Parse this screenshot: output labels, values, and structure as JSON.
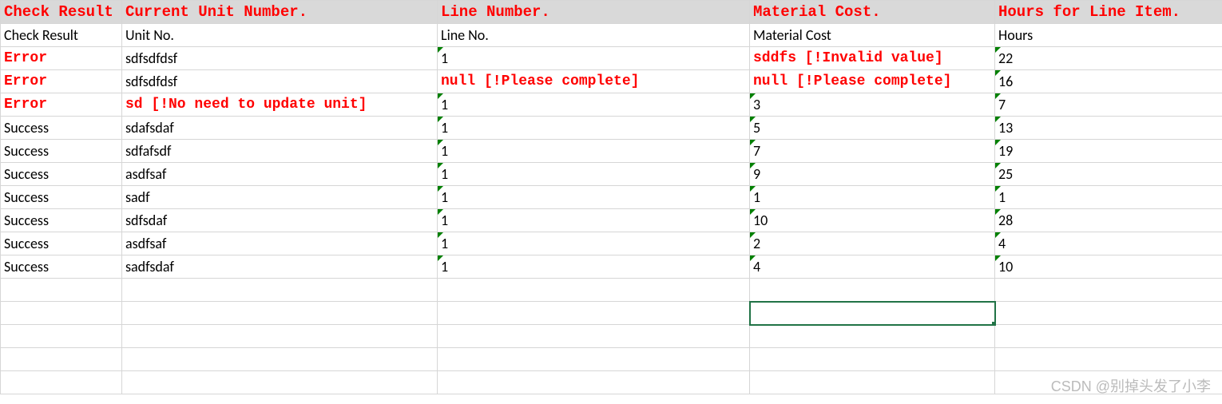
{
  "header": {
    "cols": [
      "Check Result",
      "Current Unit Number.",
      "Line Number.",
      "Material Cost.",
      "Hours for Line Item."
    ]
  },
  "labels": {
    "cols": [
      "Check Result",
      "Unit No.",
      "Line No.",
      "Material Cost",
      "Hours"
    ]
  },
  "rows": [
    {
      "status": {
        "text": "Error",
        "err": true
      },
      "unit": {
        "text": "sdfsdfdsf",
        "err": false
      },
      "line": {
        "text": "1",
        "err": false,
        "flag": true
      },
      "cost": {
        "text": "sddfs [!Invalid value]",
        "err": true
      },
      "hours": {
        "text": "22",
        "err": false,
        "flag": true
      }
    },
    {
      "status": {
        "text": "Error",
        "err": true
      },
      "unit": {
        "text": "sdfsdfdsf",
        "err": false
      },
      "line": {
        "text": "null [!Please complete]",
        "err": true
      },
      "cost": {
        "text": "null [!Please complete]",
        "err": true
      },
      "hours": {
        "text": "16",
        "err": false,
        "flag": true
      }
    },
    {
      "status": {
        "text": "Error",
        "err": true
      },
      "unit": {
        "text": "sd [!No need to update unit]",
        "err": true
      },
      "line": {
        "text": "1",
        "err": false,
        "flag": true
      },
      "cost": {
        "text": "3",
        "err": false,
        "flag": true
      },
      "hours": {
        "text": "7",
        "err": false,
        "flag": true
      }
    },
    {
      "status": {
        "text": "Success",
        "err": false
      },
      "unit": {
        "text": "sdafsdaf",
        "err": false
      },
      "line": {
        "text": "1",
        "err": false,
        "flag": true
      },
      "cost": {
        "text": "5",
        "err": false,
        "flag": true
      },
      "hours": {
        "text": "13",
        "err": false,
        "flag": true
      }
    },
    {
      "status": {
        "text": "Success",
        "err": false
      },
      "unit": {
        "text": "sdfafsdf",
        "err": false
      },
      "line": {
        "text": "1",
        "err": false,
        "flag": true
      },
      "cost": {
        "text": "7",
        "err": false,
        "flag": true
      },
      "hours": {
        "text": "19",
        "err": false,
        "flag": true
      }
    },
    {
      "status": {
        "text": "Success",
        "err": false
      },
      "unit": {
        "text": "asdfsaf",
        "err": false
      },
      "line": {
        "text": "1",
        "err": false,
        "flag": true
      },
      "cost": {
        "text": "9",
        "err": false,
        "flag": true
      },
      "hours": {
        "text": "25",
        "err": false,
        "flag": true
      }
    },
    {
      "status": {
        "text": "Success",
        "err": false
      },
      "unit": {
        "text": "sadf",
        "err": false
      },
      "line": {
        "text": "1",
        "err": false,
        "flag": true
      },
      "cost": {
        "text": "1",
        "err": false,
        "flag": true
      },
      "hours": {
        "text": "1",
        "err": false,
        "flag": true
      }
    },
    {
      "status": {
        "text": "Success",
        "err": false
      },
      "unit": {
        "text": "sdfsdaf",
        "err": false
      },
      "line": {
        "text": "1",
        "err": false,
        "flag": true
      },
      "cost": {
        "text": "10",
        "err": false,
        "flag": true
      },
      "hours": {
        "text": "28",
        "err": false,
        "flag": true
      }
    },
    {
      "status": {
        "text": "Success",
        "err": false
      },
      "unit": {
        "text": "asdfsaf",
        "err": false
      },
      "line": {
        "text": "1",
        "err": false,
        "flag": true
      },
      "cost": {
        "text": "2",
        "err": false,
        "flag": true
      },
      "hours": {
        "text": "4",
        "err": false,
        "flag": true
      }
    },
    {
      "status": {
        "text": "Success",
        "err": false
      },
      "unit": {
        "text": "sadfsdaf",
        "err": false
      },
      "line": {
        "text": "1",
        "err": false,
        "flag": true
      },
      "cost": {
        "text": "4",
        "err": false,
        "flag": true
      },
      "hours": {
        "text": "10",
        "err": false,
        "flag": true
      }
    }
  ],
  "emptyRows": 5,
  "activeCell": {
    "row": 13,
    "col": 3
  },
  "watermark": "CSDN @别掉头发了小李"
}
